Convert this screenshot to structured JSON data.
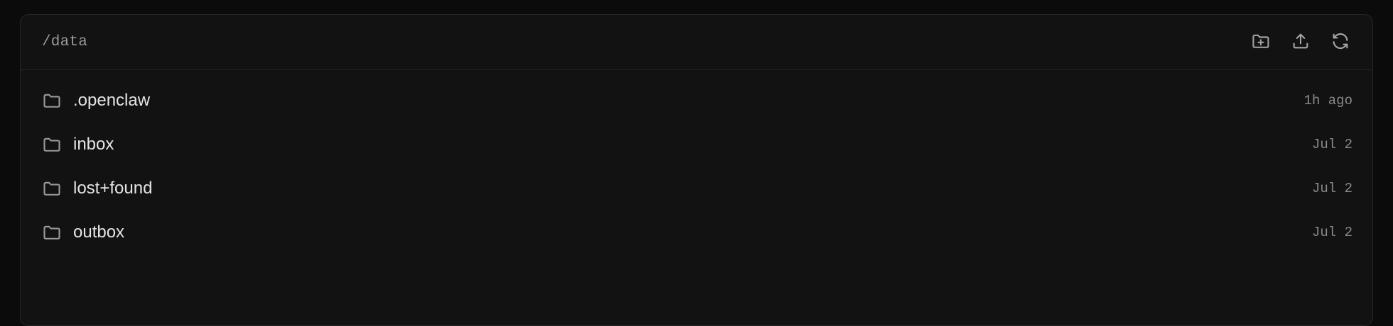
{
  "header": {
    "path": "/data",
    "actions": [
      {
        "icon": "new-folder-icon"
      },
      {
        "icon": "upload-icon"
      },
      {
        "icon": "refresh-icon"
      }
    ]
  },
  "items": [
    {
      "name": ".openclaw",
      "modified": "1h ago",
      "icon": "folder-icon"
    },
    {
      "name": "inbox",
      "modified": "Jul 2",
      "icon": "folder-icon"
    },
    {
      "name": "lost+found",
      "modified": "Jul 2",
      "icon": "folder-icon"
    },
    {
      "name": "outbox",
      "modified": "Jul 2",
      "icon": "folder-icon"
    }
  ],
  "colors": {
    "background": "#0b0b0b",
    "panel": "#121212",
    "border": "#262626",
    "text": "#e4e4e4",
    "muted": "#8a8a8a"
  }
}
